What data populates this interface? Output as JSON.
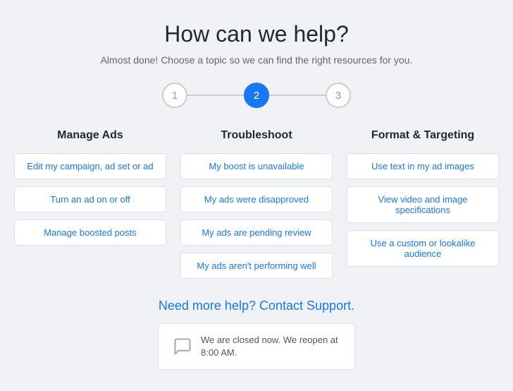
{
  "header": {
    "title": "How can we help?",
    "subtitle": "Almost done! Choose a topic so we can find the right resources for you."
  },
  "steps": [
    {
      "label": "1",
      "active": false
    },
    {
      "label": "2",
      "active": true
    },
    {
      "label": "3",
      "active": false
    }
  ],
  "columns": [
    {
      "title": "Manage Ads",
      "items": [
        "Edit my campaign, ad set or ad",
        "Turn an ad on or off",
        "Manage boosted posts"
      ]
    },
    {
      "title": "Troubleshoot",
      "items": [
        "My boost is unavailable",
        "My ads were disapproved",
        "My ads are pending review",
        "My ads aren't performing well"
      ]
    },
    {
      "title": "Format & Targeting",
      "items": [
        "Use text in my ad images",
        "View video and image specifications",
        "Use a custom or lookalike audience"
      ]
    }
  ],
  "support": {
    "title_text": "Need more help?",
    "link_text": "Contact Support.",
    "message": "We are closed now. We reopen at 8:00 AM."
  }
}
